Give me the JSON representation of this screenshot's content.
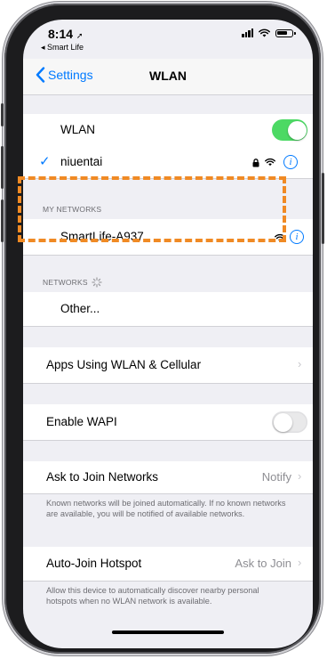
{
  "status": {
    "time": "8:14",
    "back_app": "◂ Smart Life"
  },
  "nav": {
    "back_label": "Settings",
    "title": "WLAN"
  },
  "wlan_row": {
    "label": "WLAN",
    "toggle_on": true
  },
  "connected": {
    "name": "niuentai"
  },
  "my_networks": {
    "header": "MY NETWORKS",
    "items": [
      {
        "name": "SmartLife-A937"
      }
    ]
  },
  "networks": {
    "header": "NETWORKS",
    "other_label": "Other..."
  },
  "apps_row": {
    "label": "Apps Using WLAN & Cellular"
  },
  "wapi_row": {
    "label": "Enable WAPI",
    "toggle_on": false
  },
  "ask_join": {
    "label": "Ask to Join Networks",
    "value": "Notify",
    "footer": "Known networks will be joined automatically. If no known networks are available, you will be notified of available networks."
  },
  "auto_join": {
    "label": "Auto-Join Hotspot",
    "value": "Ask to Join",
    "footer": "Allow this device to automatically discover nearby personal hotspots when no WLAN network is available."
  },
  "colors": {
    "accent": "#007aff",
    "toggle_on": "#4cd964",
    "highlight": "#f08a24"
  }
}
